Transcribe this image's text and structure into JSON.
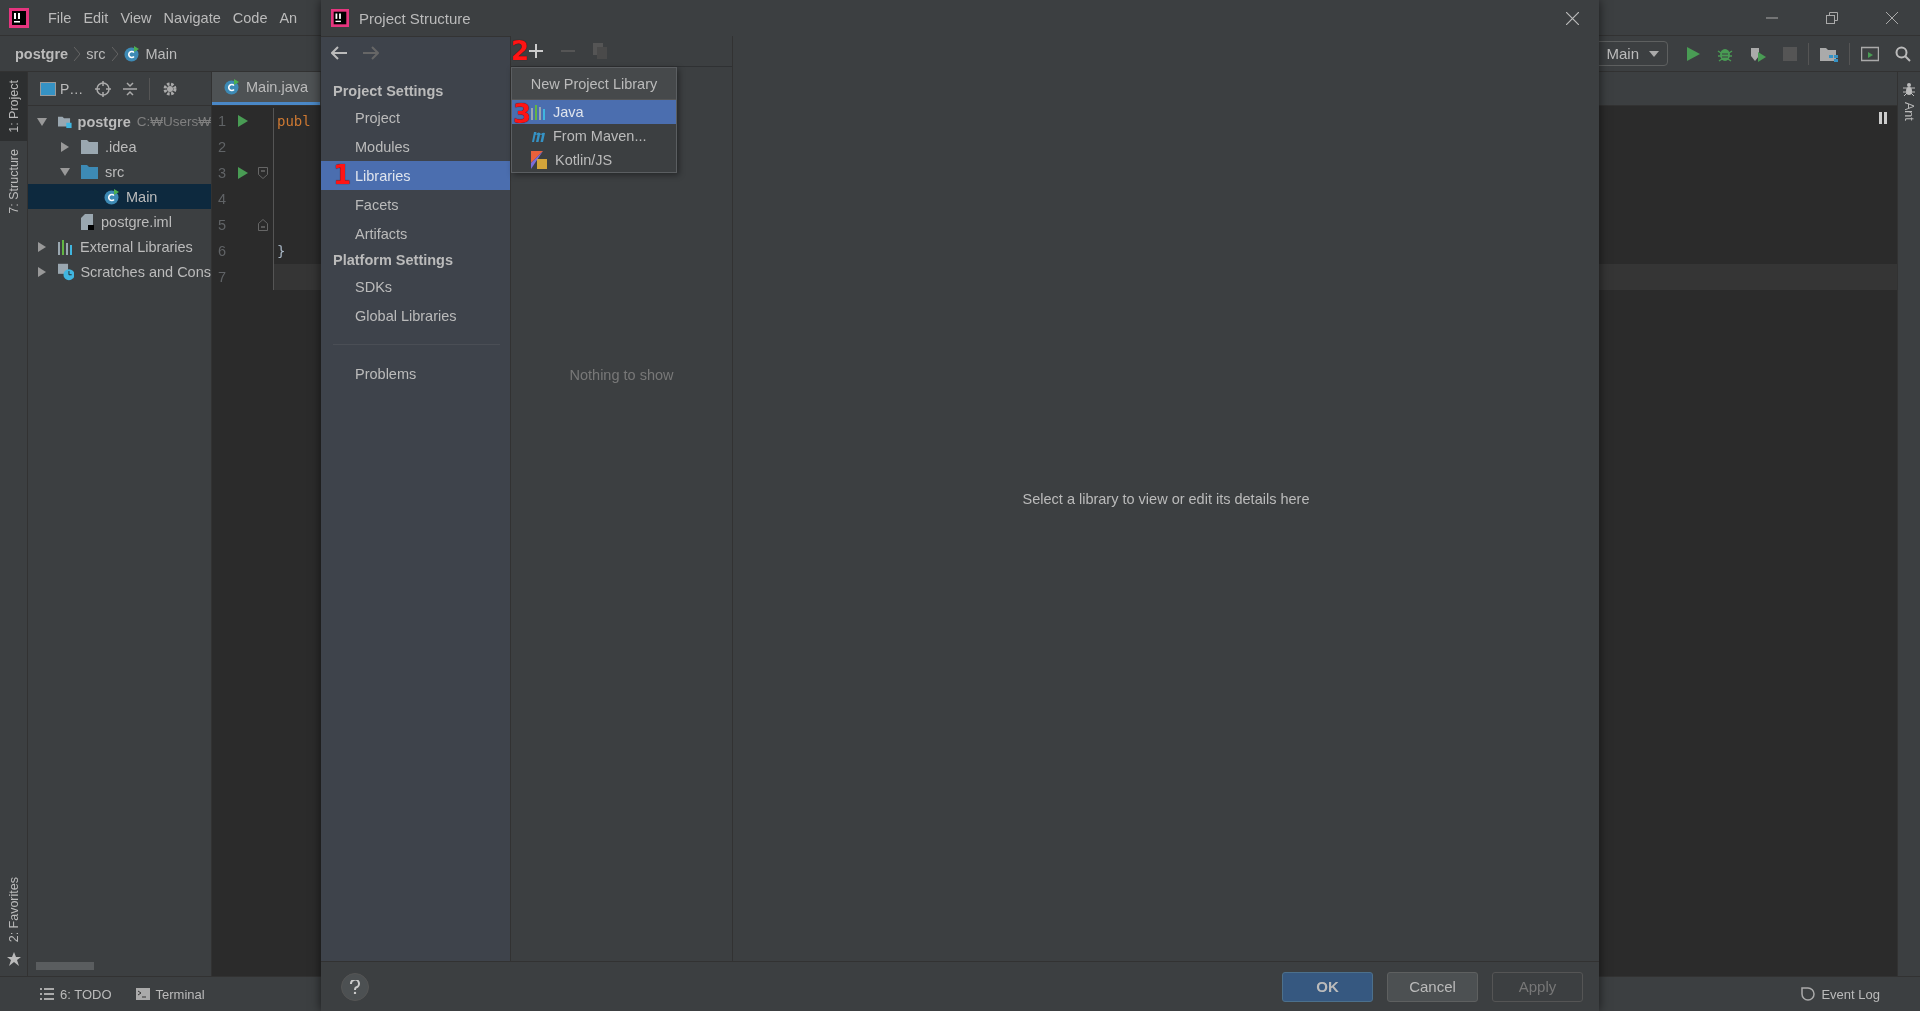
{
  "ide": {
    "menu": [
      "File",
      "Edit",
      "View",
      "Navigate",
      "Code",
      "An"
    ],
    "breadcrumb": [
      {
        "label": "postgre",
        "kind": "project"
      },
      {
        "label": "src",
        "kind": "folder"
      },
      {
        "label": "Main",
        "kind": "class"
      }
    ],
    "run_config": "Main",
    "left_tool_windows": [
      {
        "label": "1: Project",
        "selected": true
      },
      {
        "label": "7: Structure",
        "selected": false
      }
    ],
    "favorites": "2: Favorites",
    "right_tool_windows": [
      "Ant"
    ],
    "project": {
      "view_selector": "P…",
      "tree": [
        {
          "label": "postgre",
          "hint": "C:₩Users₩",
          "kind": "module",
          "bold": true,
          "expanded": true,
          "selected": false,
          "children": [
            {
              "label": ".idea",
              "kind": "folder",
              "expanded": false,
              "selected": false
            },
            {
              "label": "src",
              "kind": "source",
              "expanded": true,
              "selected": false,
              "children": [
                {
                  "label": "Main",
                  "kind": "class",
                  "selected": true
                }
              ]
            },
            {
              "label": "postgre.iml",
              "kind": "file",
              "selected": false
            }
          ]
        },
        {
          "label": "External Libraries",
          "kind": "libraries",
          "expanded": false,
          "selected": false
        },
        {
          "label": "Scratches and Cons",
          "kind": "scratches",
          "expanded": false,
          "selected": false
        }
      ]
    },
    "editor": {
      "tab": "Main.java",
      "lines": [
        {
          "number": "1",
          "code": "publ",
          "kind": "plain",
          "run": true,
          "current": false
        },
        {
          "number": "2",
          "kind": "plain",
          "run": false,
          "current": false
        },
        {
          "number": "3",
          "kind": "fold_start",
          "run": true,
          "current": false
        },
        {
          "number": "4",
          "kind": "plain",
          "run": false,
          "current": false
        },
        {
          "number": "5",
          "kind": "fold_end",
          "run": false,
          "current": false
        },
        {
          "number": "6",
          "code": "}",
          "kind": "plain",
          "run": false,
          "current": false
        },
        {
          "number": "7",
          "kind": "plain",
          "run": false,
          "current": true
        }
      ]
    },
    "bottom_tools": [
      {
        "label": "6: TODO",
        "kind": "todo"
      },
      {
        "label": "Terminal",
        "kind": "terminal"
      }
    ],
    "event_log": "Event Log"
  },
  "dialog": {
    "title": "Project Structure",
    "history": {
      "back_disabled": false,
      "forward_disabled": true
    },
    "nav": [
      {
        "kind": "header",
        "label": "Project Settings"
      },
      {
        "kind": "item",
        "label": "Project",
        "selected": false
      },
      {
        "kind": "item",
        "label": "Modules",
        "selected": false
      },
      {
        "kind": "item",
        "label": "Libraries",
        "selected": true,
        "annotation": "1"
      },
      {
        "kind": "item",
        "label": "Facets",
        "selected": false
      },
      {
        "kind": "item",
        "label": "Artifacts",
        "selected": false
      },
      {
        "kind": "header",
        "label": "Platform Settings"
      },
      {
        "kind": "item",
        "label": "SDKs",
        "selected": false
      },
      {
        "kind": "item",
        "label": "Global Libraries",
        "selected": false
      },
      {
        "kind": "separator"
      },
      {
        "kind": "item",
        "label": "Problems",
        "selected": false
      }
    ],
    "toolbar": [
      {
        "kind": "add",
        "disabled": false,
        "annotation": "2"
      },
      {
        "kind": "remove",
        "disabled": true
      },
      {
        "kind": "copy",
        "disabled": true
      }
    ],
    "popup": {
      "title": "New Project Library",
      "items": [
        {
          "label": "Java",
          "kind": "java",
          "selected": true,
          "annotation": "3"
        },
        {
          "label": "From Maven...",
          "kind": "maven",
          "selected": false
        },
        {
          "label": "Kotlin/JS",
          "kind": "kotlin",
          "selected": false
        }
      ]
    },
    "empty_text": "Nothing to show",
    "details_hint": "Select a library to view or edit its details here",
    "buttons": [
      {
        "label": "OK",
        "kind": "primary",
        "disabled": false
      },
      {
        "label": "Cancel",
        "kind": "normal",
        "disabled": false
      },
      {
        "label": "Apply",
        "kind": "normal",
        "disabled": true
      }
    ]
  }
}
